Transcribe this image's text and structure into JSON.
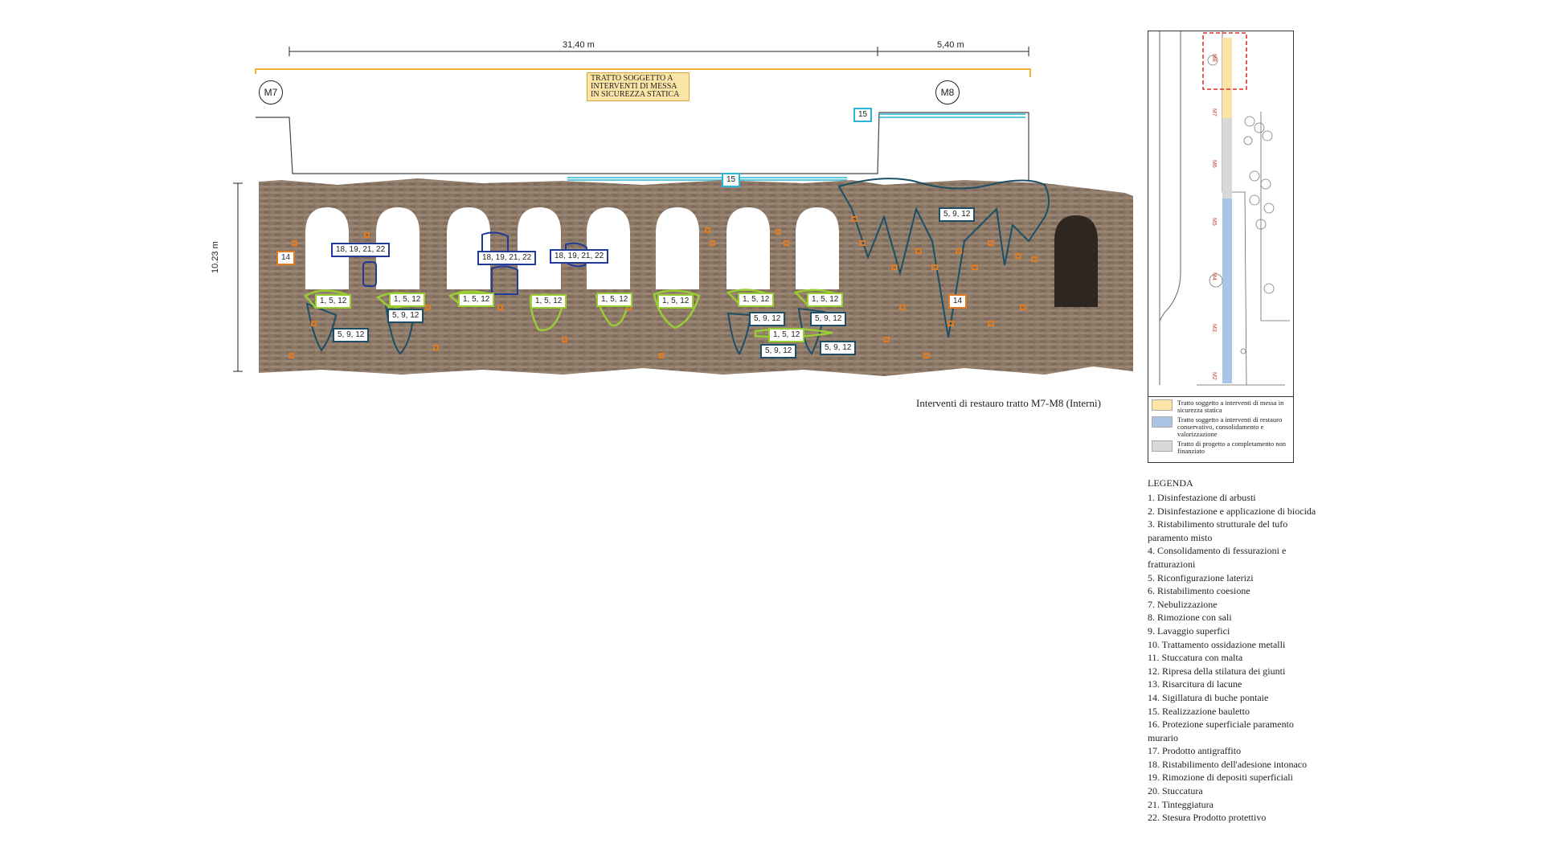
{
  "dimensions": {
    "top_left": "31,40 m",
    "top_right": "5,40 m",
    "height": "10.23 m"
  },
  "markers": {
    "m7": "M7",
    "m8": "M8"
  },
  "notice": "TRATTO SOGGETTO A INTERVENTI DI MESSA IN SICUREZZA STATICA",
  "tags": {
    "t15_top": "15",
    "t15_wall": "15",
    "t14_left": "14",
    "t14_right": "14",
    "t18_a": "18, 19, 21, 22",
    "t18_b": "18, 19, 21, 22",
    "t18_c": "18, 19, 21, 22",
    "t1512_a": "1, 5, 12",
    "t1512_b": "1, 5, 12",
    "t1512_c": "1, 5, 12",
    "t1512_d": "1, 5, 12",
    "t1512_e": "1, 5, 12",
    "t1512_f": "1, 5, 12",
    "t1512_g": "1, 5, 12",
    "t1512_h": "1, 5, 12",
    "t1512_i": "1, 5, 12",
    "t5912_a": "5, 9, 12",
    "t5912_b": "5, 9, 12",
    "t5912_c": "5, 9, 12",
    "t5912_d": "5, 9, 12",
    "t5912_e": "5, 9, 12",
    "t5912_f": "5, 9, 12",
    "t5912_g": "5, 9, 12"
  },
  "caption": "Interventi di restauro tratto M7-M8 (Interni)",
  "key_map": {
    "labels": [
      "M8",
      "M7",
      "M6",
      "M5",
      "M4",
      "M3",
      "M2"
    ],
    "rows": [
      {
        "color": "#fbe5a6",
        "text": "Tratto soggetto a interventi di messa in sicurezza statica"
      },
      {
        "color": "#a9c4e6",
        "text": "Tratto soggetto a interventi di restauro conservativo, consolidamento e valorizzazione"
      },
      {
        "color": "#d8d8d8",
        "text": "Tratto di progetto a completamento non finanziato"
      }
    ]
  },
  "legend": {
    "title": "LEGENDA",
    "items": [
      "1. Disinfestazione di arbusti",
      "2. Disinfestazione e applicazione di biocida",
      "3. Ristabilimento strutturale del tufo paramento misto",
      "4. Consolidamento di fessurazioni e fratturazioni",
      "5. Riconfigurazione laterizi",
      "6. Ristabilimento coesione",
      "7. Nebulizzazione",
      "8. Rimozione con sali",
      "9. Lavaggio superfici",
      "10. Trattamento ossidazione metalli",
      "11. Stuccatura con malta",
      "12. Ripresa della stilatura dei giunti",
      "13. Risarcitura di lacune",
      "14. Sigillatura di buche pontaie",
      "15. Realizzazione bauletto",
      "16. Protezione superficiale paramento murario",
      "17. Prodotto antigraffito",
      "18. Ristabilimento dell'adesione intonaco",
      "19.  Rimozione di depositi superficiali",
      "20. Stuccatura",
      "21. Tinteggiatura",
      "22. Stesura Prodotto protettivo"
    ]
  },
  "colors": {
    "orange": "#e07a20",
    "green": "#9acd32",
    "navy": "#1f3a99",
    "teal": "#1c4f66",
    "cyan": "#26b6d6",
    "yellow": "#f0b030"
  }
}
